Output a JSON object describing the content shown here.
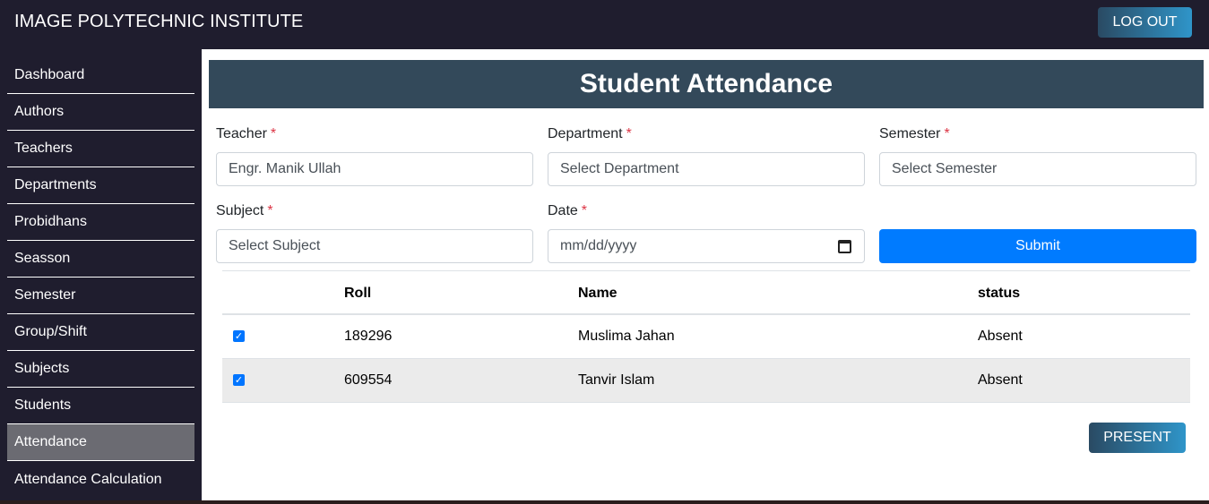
{
  "header": {
    "title": "IMAGE POLYTECHNIC INSTITUTE",
    "logout_label": "LOG OUT"
  },
  "sidebar": {
    "items": [
      {
        "label": "Dashboard"
      },
      {
        "label": "Authors"
      },
      {
        "label": "Teachers"
      },
      {
        "label": "Departments"
      },
      {
        "label": "Probidhans"
      },
      {
        "label": "Seasson"
      },
      {
        "label": "Semester"
      },
      {
        "label": "Group/Shift"
      },
      {
        "label": "Subjects"
      },
      {
        "label": "Students"
      },
      {
        "label": "Attendance"
      },
      {
        "label": "Attendance Calculation"
      }
    ],
    "active_item": "Attendance"
  },
  "main": {
    "title": "Student Attendance",
    "form": {
      "required_mark": "*",
      "teacher": {
        "label": "Teacher",
        "value": "Engr. Manik Ullah"
      },
      "department": {
        "label": "Department",
        "value": "Select Department"
      },
      "semester": {
        "label": "Semester",
        "value": "Select Semester"
      },
      "subject": {
        "label": "Subject",
        "value": "Select Subject"
      },
      "date": {
        "label": "Date",
        "placeholder": "mm/dd/yyyy"
      },
      "submit_label": "Submit"
    },
    "table": {
      "headers": {
        "select": "",
        "roll": "Roll",
        "name": "Name",
        "status": "status"
      },
      "rows": [
        {
          "checked": true,
          "roll": "189296",
          "name": "Muslima Jahan",
          "status": "Absent"
        },
        {
          "checked": true,
          "roll": "609554",
          "name": "Tanvir Islam",
          "status": "Absent"
        }
      ]
    },
    "present_label": "PRESENT"
  },
  "colors": {
    "topbar_bg": "#1f1d2e",
    "title_bar_bg": "#33495a",
    "submit_bg": "#007bff",
    "active_sidebar_bg": "#6b6b72",
    "required": "#dc3545"
  }
}
